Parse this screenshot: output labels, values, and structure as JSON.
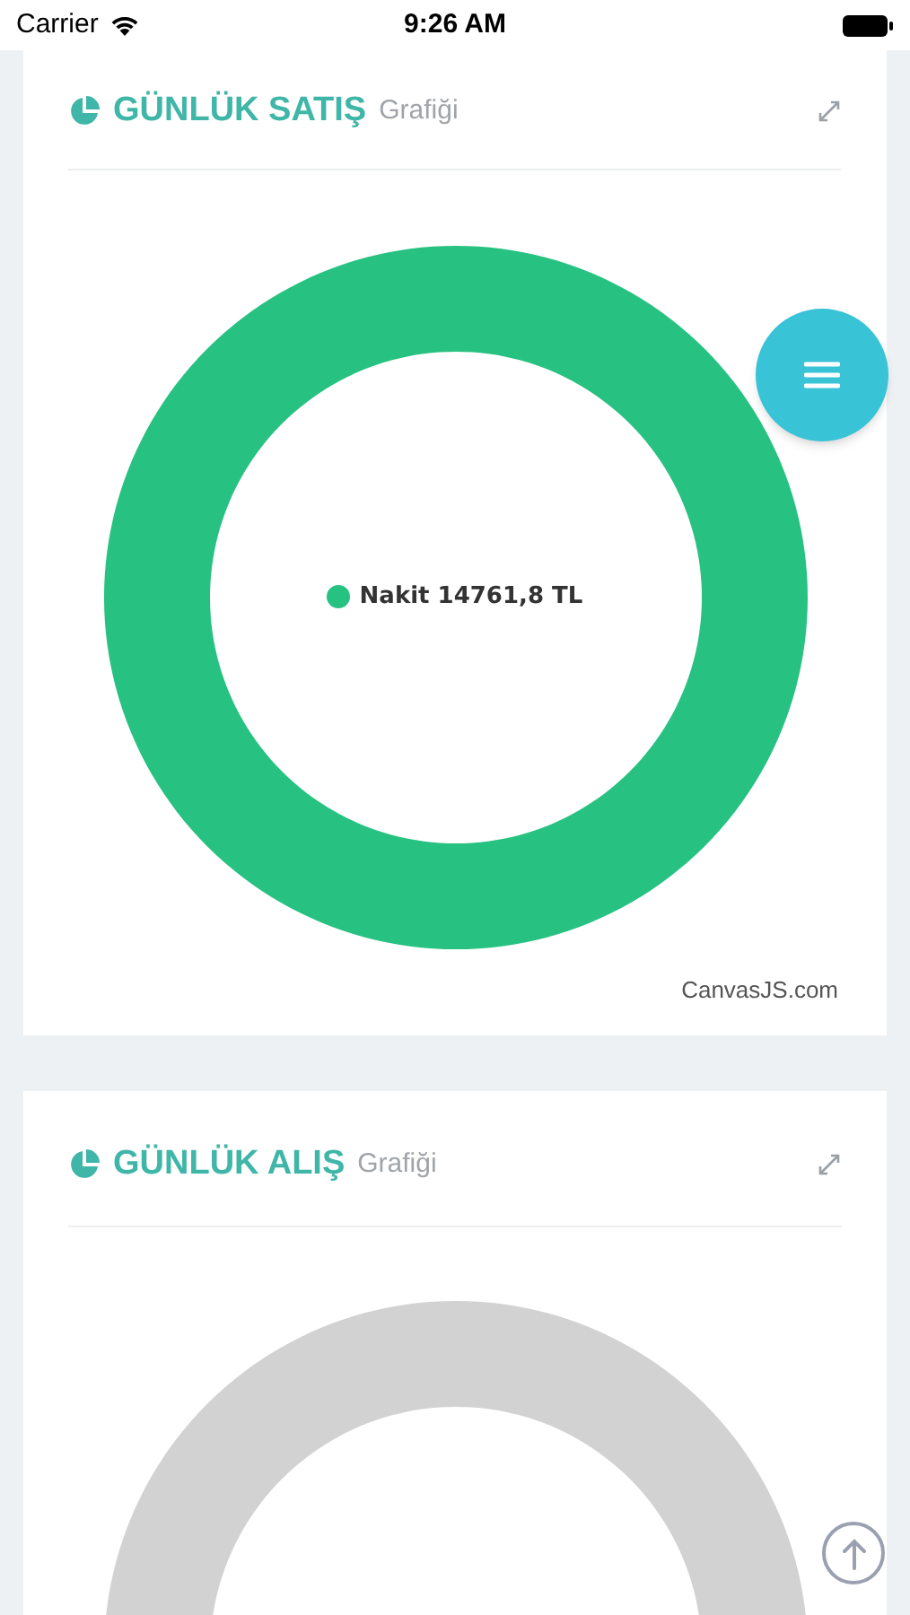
{
  "status_bar": {
    "carrier": "Carrier",
    "time": "9:26 AM"
  },
  "cards": [
    {
      "kind": "donut",
      "title": "GÜNLÜK SATIŞ",
      "subtitle": "Grafiği",
      "legend": "Nakit 14761,8 TL",
      "color": "#27c281",
      "credit": "CanvasJS.com"
    },
    {
      "kind": "empty",
      "title": "GÜNLÜK ALIŞ",
      "subtitle": "Grafiği",
      "color": "#d2d2d2"
    }
  ]
}
